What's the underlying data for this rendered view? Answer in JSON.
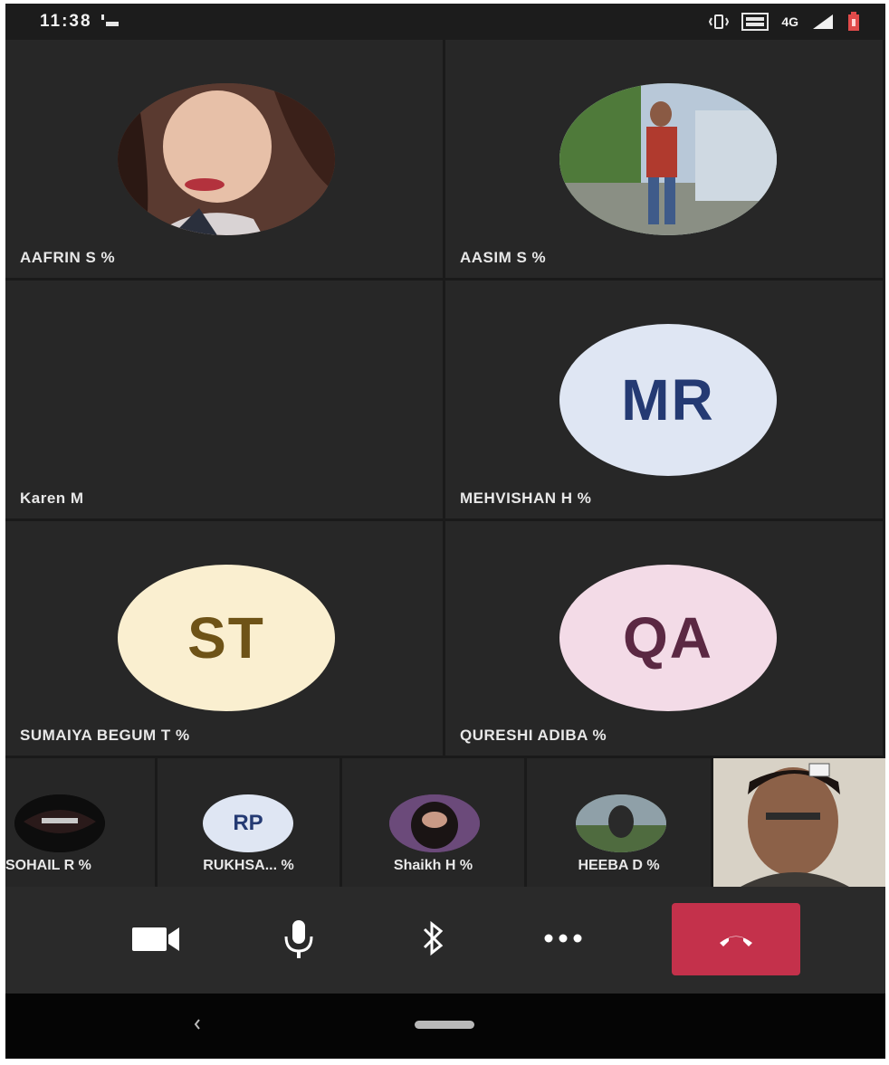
{
  "status_bar": {
    "time": "11:38",
    "network_label": "4G",
    "icons": [
      "notification-icon",
      "vibrate-icon",
      "data-icon",
      "signal-icon",
      "battery-icon"
    ]
  },
  "participants": [
    {
      "name": "AAFRIN S %",
      "display": "video"
    },
    {
      "name": "AASIM S %",
      "display": "video"
    },
    {
      "name": "Karen M",
      "display": "blank"
    },
    {
      "name": "MEHVISHAN H %",
      "initials": "MR",
      "avatar_color": "#dfe6f3",
      "initials_color": "#243a73"
    },
    {
      "name": "SUMAIYA BEGUM T %",
      "initials": "ST",
      "avatar_color": "#faefd0",
      "initials_color": "#6e5317"
    },
    {
      "name": "QURESHI ADIBA %",
      "initials": "QA",
      "avatar_color": "#f3dbe7",
      "initials_color": "#5b2843"
    }
  ],
  "strip": [
    {
      "name": "SOHAIL R %"
    },
    {
      "name": "RUKHSA... %",
      "initials": "RP",
      "avatar_color": "#dfe6f3",
      "initials_color": "#243a73"
    },
    {
      "name": "Shaikh H %"
    },
    {
      "name": "HEEBA D %"
    }
  ],
  "controls": {
    "icons": [
      "video-camera-icon",
      "microphone-icon",
      "bluetooth-icon",
      "more-icon",
      "hang-up-icon"
    ],
    "hangup_color": "#c4314b"
  },
  "nav": {
    "icons": [
      "back-icon",
      "home-icon"
    ]
  }
}
